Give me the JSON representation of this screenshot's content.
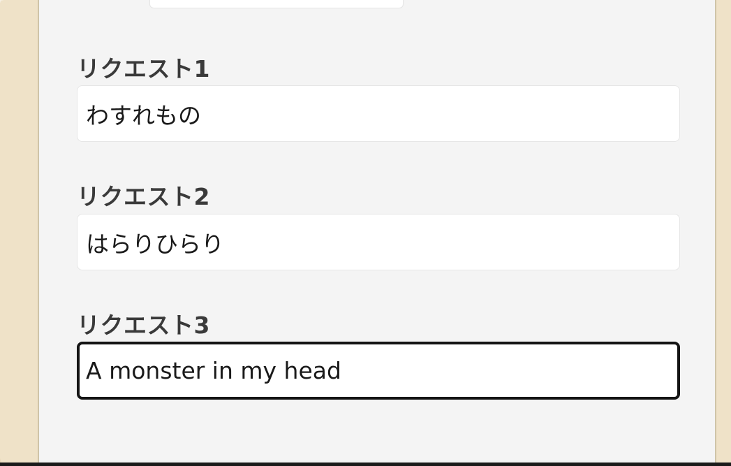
{
  "form": {
    "fields": [
      {
        "label": "リクエスト1",
        "value": "わすれもの"
      },
      {
        "label": "リクエスト2",
        "value": "はらりひらり"
      },
      {
        "label": "リクエスト3",
        "value": "A monster in my head"
      }
    ]
  },
  "colors": {
    "panel_background": "#f4f4f4",
    "page_background": "#efe2c8",
    "label_text": "#3a3a3a",
    "focus_border": "#141414"
  }
}
